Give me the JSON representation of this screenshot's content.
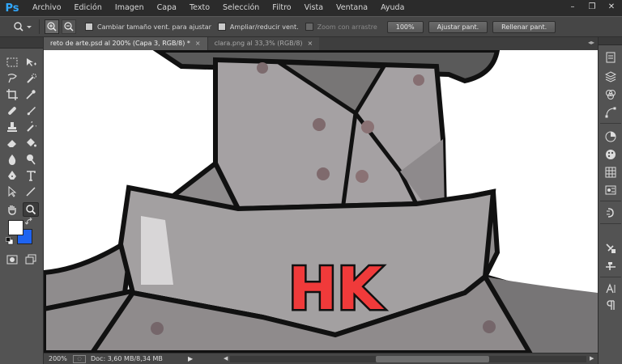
{
  "app": {
    "logo": "Ps"
  },
  "menu": [
    "Archivo",
    "Edición",
    "Imagen",
    "Capa",
    "Texto",
    "Selección",
    "Filtro",
    "Vista",
    "Ventana",
    "Ayuda"
  ],
  "window_controls": {
    "minimize": "–",
    "restore": "❐",
    "close": "✕"
  },
  "options": {
    "resize_windows_label": "Cambiar tamaño vent. para ajustar",
    "zoom_all_label": "Ampliar/reducir vent.",
    "scrubby_zoom_label": "Zoom con arrastre",
    "btn_100": "100%",
    "btn_fit": "Ajustar pant.",
    "btn_fill": "Rellenar pant."
  },
  "tabs": [
    {
      "label": "reto de arte.psd al 200% (Capa 3, RGB/8) *",
      "close": "×"
    },
    {
      "label": "clara.png al 33,3% (RGB/8)",
      "close": "×"
    }
  ],
  "canvas": {
    "badge_text": "HK"
  },
  "status": {
    "zoom": "200%",
    "doc_info": "Doc: 3,60 MB/8,34 MB",
    "arrow": "▶"
  },
  "colors": {
    "foreground": "#ffffff",
    "background": "#1e63f0",
    "accent": "#31a8ff",
    "badge_red": "#f03a3a"
  }
}
